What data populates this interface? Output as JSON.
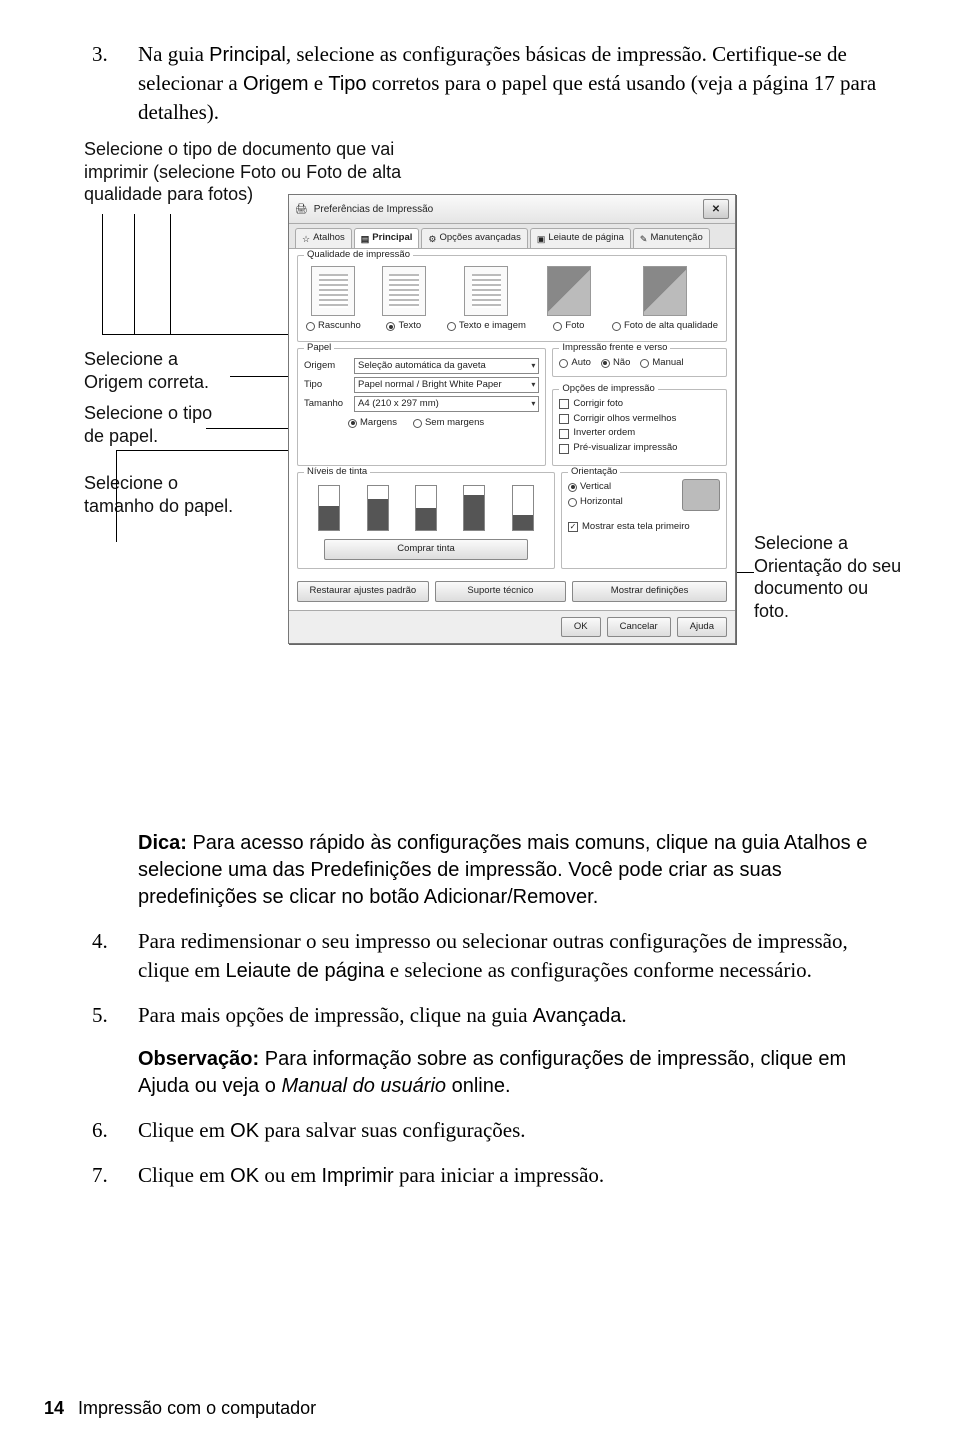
{
  "step3": {
    "num": "3.",
    "text_a": "Na guia ",
    "text_b": "Principal",
    "text_c": ", selecione as configurações básicas de impressão. Certifique-se de selecionar a ",
    "text_d": "Origem",
    "text_e": " e ",
    "text_f": "Tipo",
    "text_g": " corretos para o papel que está usando (veja a página 17 para detalhes)."
  },
  "callouts": {
    "c1a": "Selecione o tipo de documento que vai imprimir (selecione ",
    "c1b": "Foto",
    "c1c": " ou ",
    "c1d": "Foto de alta qualidade",
    "c1e": " para fotos)",
    "c2a": "Selecione a ",
    "c2b": "Origem",
    "c2c": " correta.",
    "c3": "Selecione o tipo de papel.",
    "c4": "Selecione o tamanho do papel.",
    "c5a": "Selecione a ",
    "c5b": "Orientação",
    "c5c": " do seu documento ou foto."
  },
  "dialog": {
    "title": "Preferências de Impressão",
    "tabs": {
      "t1": "Atalhos",
      "t2": "Principal",
      "t3": "Opções avançadas",
      "t4": "Leiaute de página",
      "t5": "Manutenção"
    },
    "quality": {
      "legend": "Qualidade de impressão",
      "q1": "Rascunho",
      "q2": "Texto",
      "q3": "Texto e imagem",
      "q4": "Foto",
      "q5": "Foto de alta qualidade"
    },
    "paper": {
      "legend": "Papel",
      "origem_l": "Origem",
      "origem_v": "Seleção automática da gaveta",
      "tipo_l": "Tipo",
      "tipo_v": "Papel normal / Bright White Paper",
      "tam_l": "Tamanho",
      "tam_v": "A4 (210 x 297 mm)",
      "marg": "Margens",
      "semmarg": "Sem margens"
    },
    "duplex": {
      "legend": "Impressão frente e verso",
      "auto": "Auto",
      "nao": "Não",
      "manual": "Manual",
      "opt_legend": "Opções de impressão",
      "o1": "Corrigir foto",
      "o2": "Corrigir olhos vermelhos",
      "o3": "Inverter ordem",
      "o4": "Pré-visualizar impressão"
    },
    "ink": {
      "legend": "Níveis de tinta",
      "buy": "Comprar tinta"
    },
    "ori": {
      "legend": "Orientação",
      "v": "Vertical",
      "h": "Horizontal",
      "show": "Mostrar esta tela primeiro"
    },
    "btns": {
      "b1": "Restaurar ajustes padrão",
      "b2": "Suporte técnico",
      "b3": "Mostrar definições",
      "ok": "OK",
      "cancel": "Cancelar",
      "help": "Ajuda"
    }
  },
  "tip": {
    "a": "Dica:",
    "b": " Para acesso rápido às configurações mais comuns, clique na guia ",
    "c": "Atalhos",
    "d": " e selecione uma das ",
    "e": "Predefinições de impressão",
    "f": ". Você pode criar as suas predefinições se clicar no botão ",
    "g": "Adicionar/Remover",
    "h": "."
  },
  "step4": {
    "num": "4.",
    "a": "Para redimensionar o seu impresso ou selecionar outras configurações de impressão, clique em ",
    "b": "Leiaute de página",
    "c": " e selecione as configurações conforme necessário."
  },
  "step5": {
    "num": "5.",
    "a": "Para mais opções de impressão, clique na guia ",
    "b": "Avançada",
    "c": "."
  },
  "obs": {
    "a": "Observação:",
    "b": " Para informação sobre as configurações de impressão, clique em ",
    "c": "Ajuda",
    "d": " ou veja o ",
    "e": "Manual do usuário",
    "f": " online."
  },
  "step6": {
    "num": "6.",
    "a": "Clique em ",
    "b": "OK",
    "c": " para salvar suas configurações."
  },
  "step7": {
    "num": "7.",
    "a": "Clique em ",
    "b": "OK",
    "c": " ou em ",
    "d": "Imprimir",
    "e": " para iniciar a impressão."
  },
  "footer": {
    "page": "14",
    "section": "Impressão com o computador"
  }
}
